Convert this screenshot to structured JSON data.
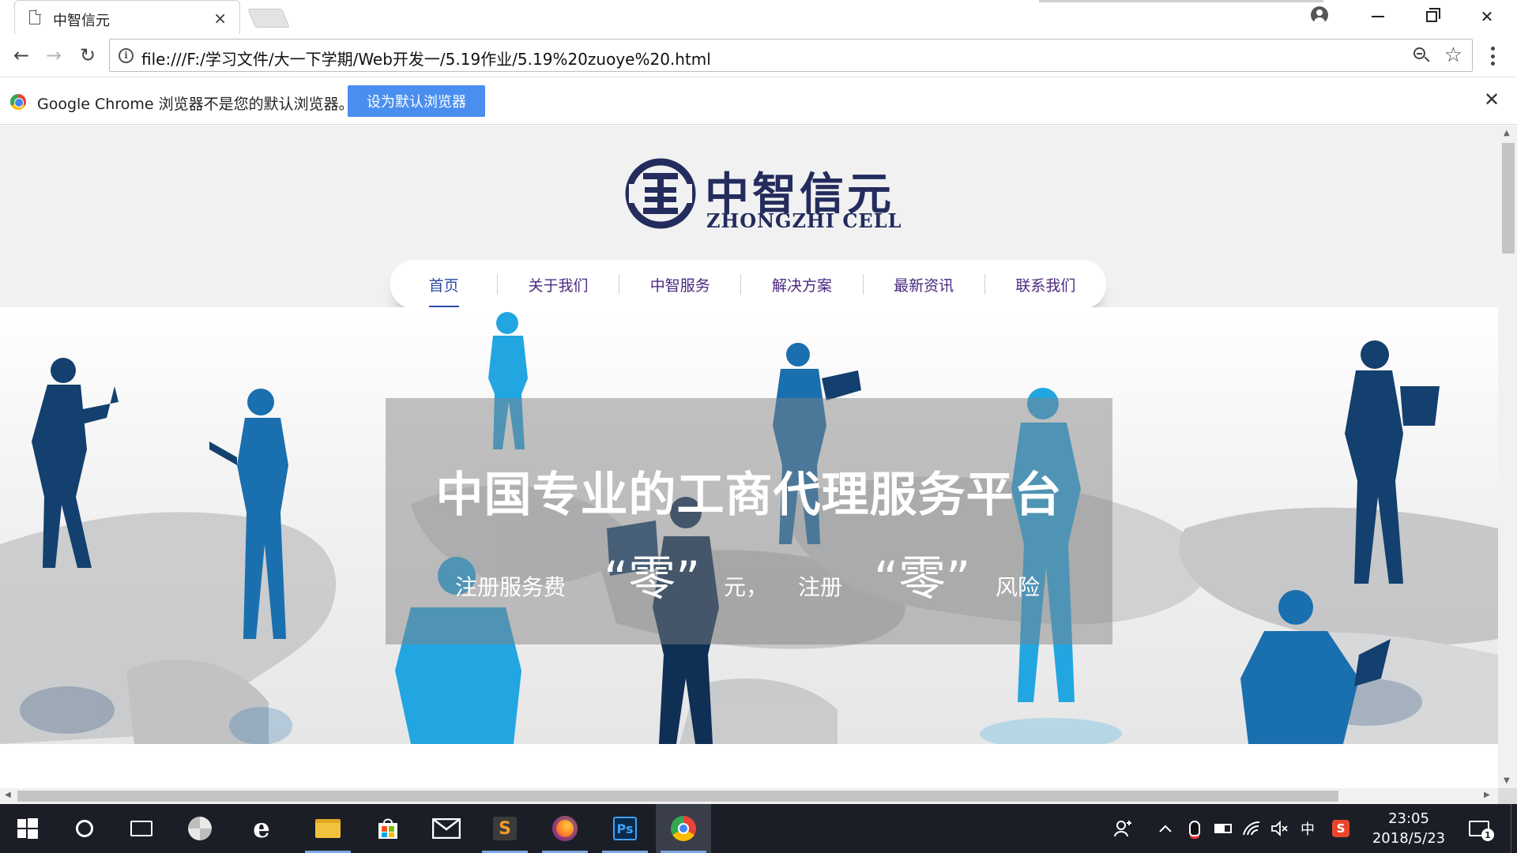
{
  "tab": {
    "title": "中智信元",
    "close": "×"
  },
  "window": {
    "minimize": "—",
    "maximize": "❐",
    "close": "✕"
  },
  "toolbar": {
    "back": "←",
    "forward": "→",
    "reload": "↻",
    "url": "file:///F:/学习文件/大一下学期/Web开发一/5.19作业/5.19%20zuoye%20.html",
    "info": "i",
    "star": "☆"
  },
  "infobar": {
    "message": "Google Chrome 浏览器不是您的默认浏览器。",
    "button": "设为默认浏览器",
    "close": "✕"
  },
  "site": {
    "logo_cn": "中智信元",
    "logo_en": "ZHONGZHI CELL",
    "nav": [
      "首页",
      "关于我们",
      "中智服务",
      "解决方案",
      "最新资讯",
      "联系我们"
    ],
    "banner": {
      "headline": "中国专业的工商代理服务平台",
      "fee_label": "注册服务费",
      "zero_1": "“零”",
      "yuan": "元，",
      "register": "注册",
      "zero_2": "“零”",
      "risk": "风险"
    }
  },
  "taskbar": {
    "clock_time": "23:05",
    "clock_date": "2018/5/23",
    "ime": "中",
    "notification_count": "1",
    "apps": [
      {
        "name": "windows-start",
        "running": false
      },
      {
        "name": "cortana",
        "running": false
      },
      {
        "name": "task-view",
        "running": false
      },
      {
        "name": "pinwheel-app",
        "running": false
      },
      {
        "name": "edge",
        "running": false
      },
      {
        "name": "file-explorer",
        "running": true
      },
      {
        "name": "store",
        "running": false
      },
      {
        "name": "mail",
        "running": false
      },
      {
        "name": "sublime-text",
        "running": true,
        "label": "S"
      },
      {
        "name": "firefox",
        "running": true
      },
      {
        "name": "photoshop",
        "running": true,
        "label": "Ps"
      },
      {
        "name": "chrome",
        "running": true
      }
    ]
  },
  "colors": {
    "brand_navy": "#232c5c",
    "nav_active": "#2c4aa8",
    "nav_text": "#4a2a80",
    "infobar_button": "#4a8ef0",
    "taskbar_bg": "#1b1e27",
    "silhouette_dark": "#13406e",
    "silhouette_mid": "#1a6fae",
    "silhouette_light": "#22a6e2"
  }
}
